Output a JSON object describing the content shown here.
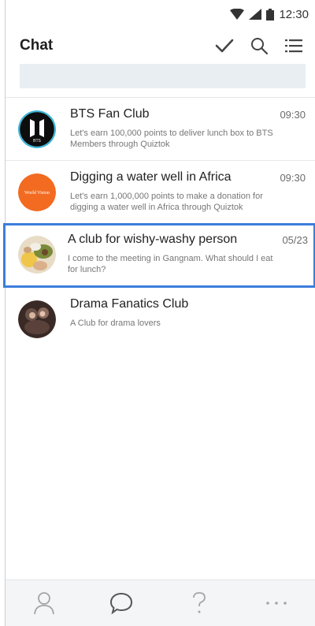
{
  "status": {
    "time": "12:30"
  },
  "header": {
    "title": "Chat"
  },
  "chats": [
    {
      "name": "BTS Fan Club",
      "time": "09:30",
      "preview": "Let's earn 100,000 points to deliver lunch box to BTS Members through Quiztok",
      "avatar_text": "BTS",
      "avatar_icon": "bts-logo-icon"
    },
    {
      "name": "Digging a water well in Africa",
      "time": "09:30",
      "preview": "Let's earn 1,000,000 points to make a donation for digging a water well in Africa through Quiztok",
      "avatar_text": "World Vision",
      "avatar_icon": "world-vision-logo-icon"
    },
    {
      "name": "A club for wishy-washy person",
      "time": "05/23",
      "preview": "I come to the meeting in Gangnam. What should I eat for lunch?",
      "avatar_icon": "food-photo-avatar"
    },
    {
      "name": "Drama Fanatics Club",
      "time": "",
      "preview": "A Club for drama lovers",
      "avatar_icon": "drama-photo-avatar"
    }
  ],
  "colors": {
    "selected_border": "#3b7ddd",
    "world_vision_orange": "#f26b21",
    "bts_ring": "#3fb6d8"
  }
}
